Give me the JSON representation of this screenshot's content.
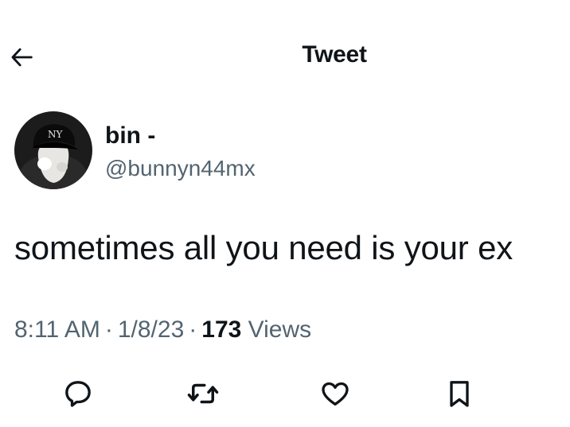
{
  "header": {
    "title": "Tweet",
    "back_icon": "arrow-left-icon"
  },
  "author": {
    "display_name": "bin -",
    "handle": "@bunnyn44mx",
    "avatar_icon": "profile-photo-avatar"
  },
  "tweet": {
    "text": "sometimes all you need is your ex",
    "time": "8:11 AM",
    "date": "1/8/23",
    "separator": "·",
    "views_count": "173",
    "views_label": "Views"
  },
  "actions": [
    {
      "name": "reply",
      "icon": "speech-bubble-icon"
    },
    {
      "name": "retweet",
      "icon": "retweet-arrows-icon"
    },
    {
      "name": "like",
      "icon": "heart-icon"
    },
    {
      "name": "bookmark",
      "icon": "bookmark-icon"
    }
  ],
  "colors": {
    "text_primary": "#0f1419",
    "text_secondary": "#536471"
  }
}
